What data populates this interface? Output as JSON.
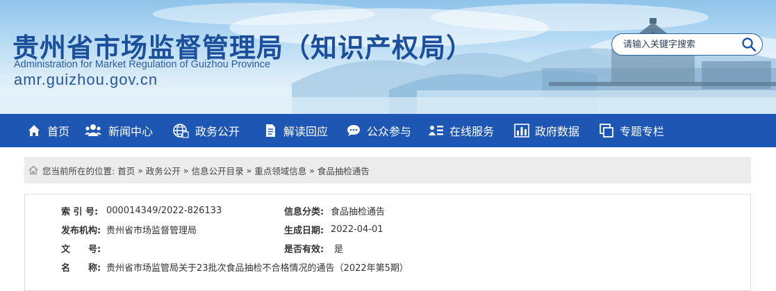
{
  "header": {
    "title": "贵州省市场监督管理局（知识产权局）",
    "subtitle": "Administration for Market Regulation of Guizhou Province",
    "url": "amr.guizhou.gov.cn",
    "search_placeholder": "请输入关键字搜索",
    "search_icon": "search-icon"
  },
  "nav": {
    "items": [
      {
        "label": "首页",
        "icon": "home-icon"
      },
      {
        "label": "新闻中心",
        "icon": "people-icon"
      },
      {
        "label": "政务公开",
        "icon": "globe-icon"
      },
      {
        "label": "解读回应",
        "icon": "document-icon"
      },
      {
        "label": "公众参与",
        "icon": "chat-icon"
      },
      {
        "label": "在线服务",
        "icon": "user-list-icon"
      },
      {
        "label": "政府数据",
        "icon": "bar-chart-icon"
      },
      {
        "label": "专题专栏",
        "icon": "window-icon"
      }
    ],
    "color": "#1d56b3"
  },
  "breadcrumb": {
    "prefix": "您当前所在的位置:",
    "items": [
      "首页",
      "政务公开",
      "信息公开目录",
      "重点领域信息",
      "食品抽检通告"
    ],
    "separator": "»"
  },
  "info": {
    "index_label": "索 引 号:",
    "index_value": "000014349/2022-826133",
    "category_label": "信息分类:",
    "category_value": "食品抽检通告",
    "publisher_label": "发布机构:",
    "publisher_value": "贵州省市场监督管理局",
    "date_label": "生成日期:",
    "date_value": "2022-04-01",
    "docno_label": "文　　号:",
    "docno_value": "",
    "valid_label": "是否有效:",
    "valid_value": "是",
    "name_label": "名　　称:",
    "name_value": "贵州省市场监管局关于23批次食品抽检不合格情况的通告（2022年第5期）"
  }
}
